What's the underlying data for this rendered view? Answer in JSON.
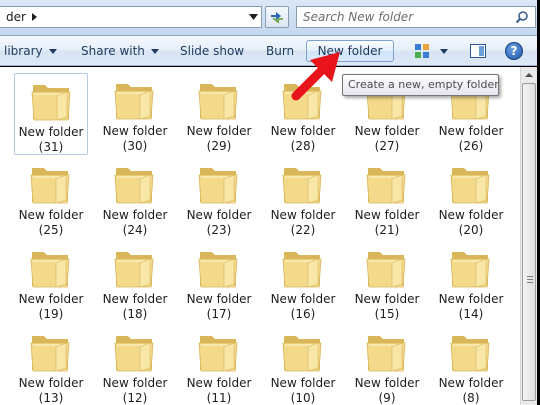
{
  "address": {
    "path_fragment": "der"
  },
  "search": {
    "placeholder": "Search New folder"
  },
  "toolbar": {
    "library_label": "library",
    "share_label": "Share with",
    "slideshow_label": "Slide show",
    "burn_label": "Burn",
    "new_folder_label": "New folder",
    "help_label": "?"
  },
  "tooltip": {
    "text": "Create a new, empty folder."
  },
  "folders": [
    {
      "name": "New folder",
      "num": "(31)"
    },
    {
      "name": "New folder",
      "num": "(30)"
    },
    {
      "name": "New folder",
      "num": "(29)"
    },
    {
      "name": "New folder",
      "num": "(28)"
    },
    {
      "name": "New folder",
      "num": "(27)"
    },
    {
      "name": "New folder",
      "num": "(26)"
    },
    {
      "name": "New folder",
      "num": "(25)"
    },
    {
      "name": "New folder",
      "num": "(24)"
    },
    {
      "name": "New folder",
      "num": "(23)"
    },
    {
      "name": "New folder",
      "num": "(22)"
    },
    {
      "name": "New folder",
      "num": "(21)"
    },
    {
      "name": "New folder",
      "num": "(20)"
    },
    {
      "name": "New folder",
      "num": "(19)"
    },
    {
      "name": "New folder",
      "num": "(18)"
    },
    {
      "name": "New folder",
      "num": "(17)"
    },
    {
      "name": "New folder",
      "num": "(16)"
    },
    {
      "name": "New folder",
      "num": "(15)"
    },
    {
      "name": "New folder",
      "num": "(14)"
    },
    {
      "name": "New folder",
      "num": "(13)"
    },
    {
      "name": "New folder",
      "num": "(12)"
    },
    {
      "name": "New folder",
      "num": "(11)"
    },
    {
      "name": "New folder",
      "num": "(10)"
    },
    {
      "name": "New folder",
      "num": "(9)"
    },
    {
      "name": "New folder",
      "num": "(8)"
    }
  ],
  "selected_folder_index": 0,
  "colors": {
    "folder": "#f3d98a",
    "folder_dark": "#d9b659",
    "accent_arrow": "#e8141b"
  }
}
